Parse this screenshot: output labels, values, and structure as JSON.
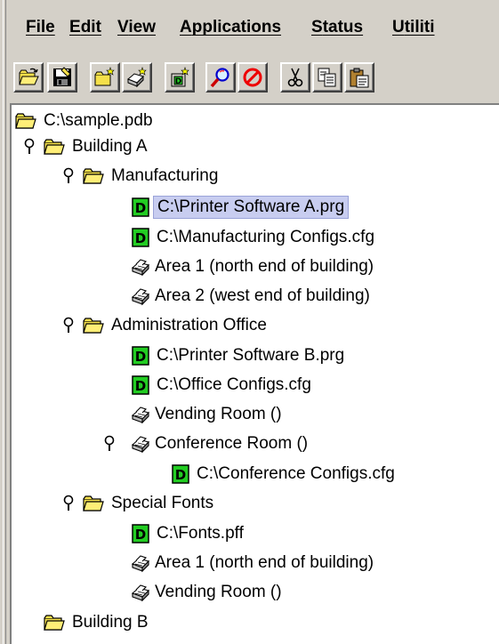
{
  "menu": {
    "items": [
      {
        "key": "F",
        "rest": "ile"
      },
      {
        "key": "E",
        "rest": "dit"
      },
      {
        "key": "V",
        "rest": "iew"
      },
      {
        "key": "A",
        "rest": "pplications"
      },
      {
        "key": "S",
        "rest": "tatus"
      },
      {
        "key": "U",
        "rest": "tiliti"
      }
    ]
  },
  "toolbar": {
    "buttons": [
      "open-folder-icon",
      "save-icon",
      "new-folder-icon",
      "new-area-icon",
      "new-device-icon",
      "find-icon",
      "stop-icon",
      "cut-icon",
      "copy-icon",
      "paste-icon"
    ]
  },
  "tree": {
    "root": "C:\\sample.pdb",
    "building_a": "Building A",
    "manufacturing": "Manufacturing",
    "mfg_printer_sw": "C:\\Printer Software A.prg",
    "mfg_configs": "C:\\Manufacturing Configs.cfg",
    "mfg_area1": "Area 1 (north end of building)",
    "mfg_area2": "Area 2 (west end of building)",
    "admin_office": "Administration Office",
    "admin_printer_sw": "C:\\Printer Software B.prg",
    "admin_configs": "C:\\Office Configs.cfg",
    "admin_vending": "Vending Room ()",
    "admin_conference": "Conference Room ()",
    "conference_configs": "C:\\Conference Configs.cfg",
    "special_fonts": "Special Fonts",
    "fonts_file": "C:\\Fonts.pff",
    "fonts_area1": "Area 1 (north end of building)",
    "fonts_vending": "Vending Room ()",
    "building_b": "Building B"
  },
  "colors": {
    "selection": "#c8cdf0",
    "folder": "#f5e04a",
    "document_badge": "#22cc22"
  }
}
